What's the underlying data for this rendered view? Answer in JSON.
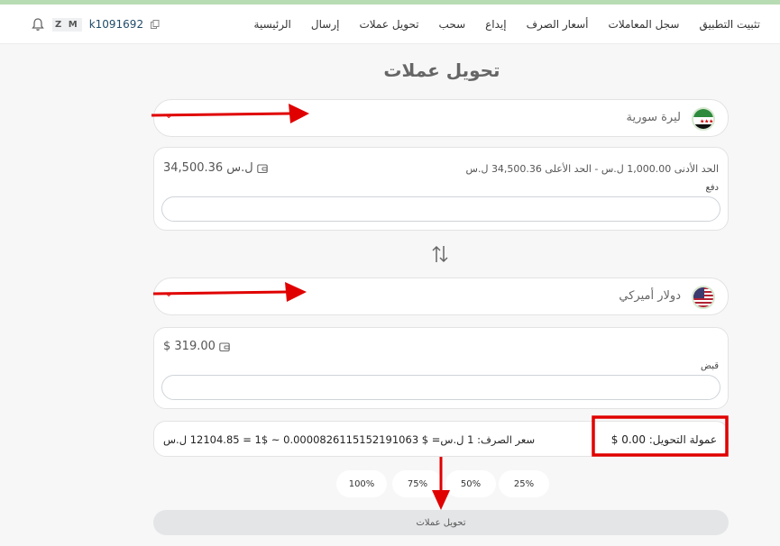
{
  "nav": {
    "items": [
      "الرئيسية",
      "إرسال",
      "تحويل عملات",
      "سحب",
      "إيداع",
      "أسعار الصرف",
      "سجل المعاملات",
      "تثبيت التطبيق"
    ],
    "user_initials": "Z M",
    "username": "k1091692"
  },
  "page_title": "تحويل عملات",
  "from": {
    "currency_name": "ليرة سورية",
    "balance": "34,500.36 ل.س",
    "limits": "الحد الأدنى 1,000.00 ل.س   -   الحد الأعلى 34,500.36 ل.س",
    "field_label": "دفع",
    "input_value": "",
    "flag_icon": "syria-flag-icon"
  },
  "to": {
    "currency_name": "دولار أميركي",
    "balance": "$ 319.00",
    "field_label": "قبض",
    "input_value": "",
    "flag_icon": "us-flag-icon"
  },
  "rate_text": "سعر الصرف: 1 ل.س= $ 0.0000826115152191063 ~ $1 = 12104.85 ل.س",
  "fee_text": "عمولة التحويل: 0.00 $",
  "percent_buttons": [
    "25%",
    "50%",
    "75%",
    "100%"
  ],
  "submit_label": "تحويل عملات",
  "colors": {
    "annotation_red": "#e00000",
    "flag_green": "#2e8b3d",
    "accent_blue": "#224d6a"
  }
}
